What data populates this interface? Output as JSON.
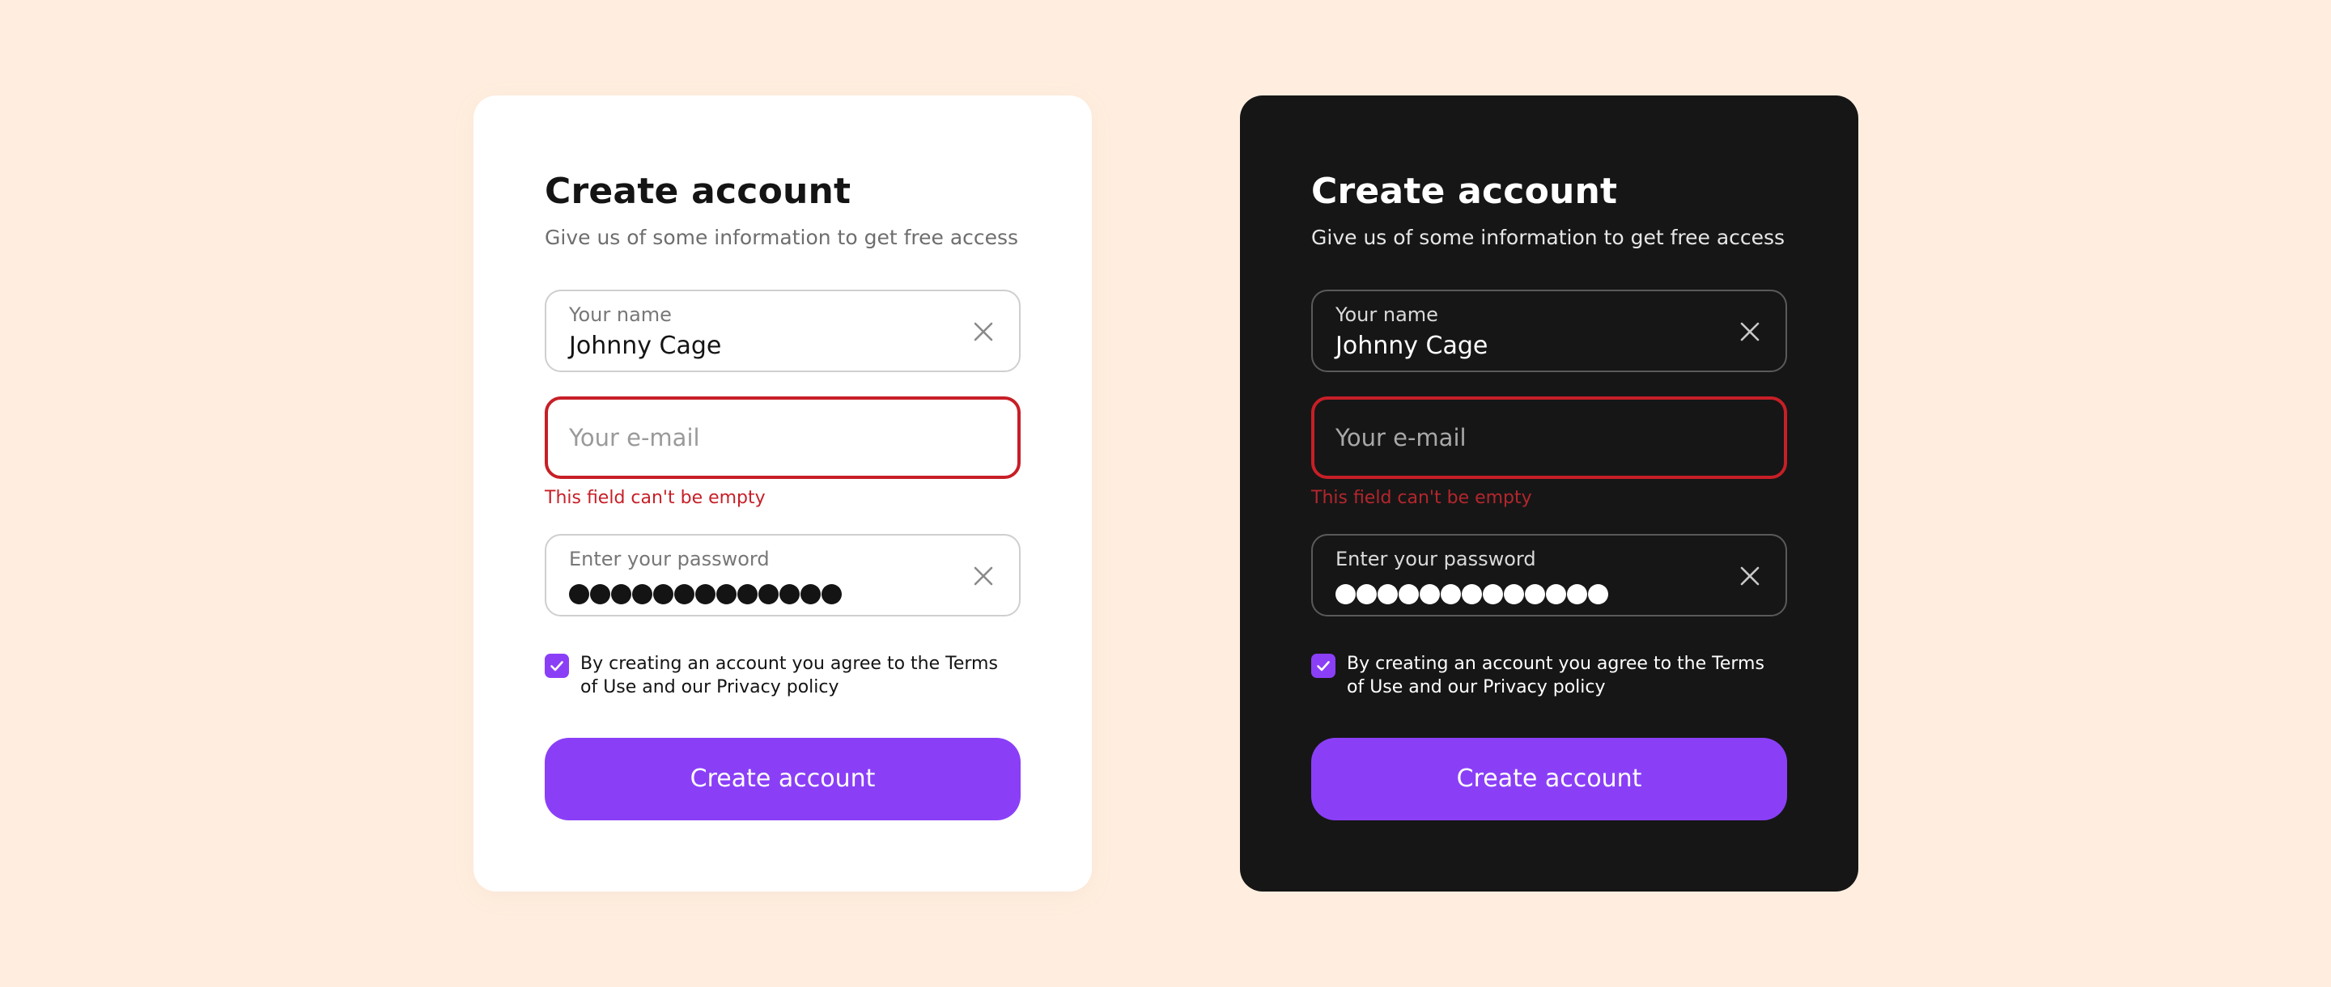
{
  "colors": {
    "background": "#FFEEDF",
    "accent": "#8A3FF7",
    "error": "#C71F27",
    "light_card": "#FFFFFF",
    "dark_card": "#161616"
  },
  "light": {
    "title": "Create account",
    "subtitle": "Give us of some information to get free access",
    "name_label": "Your name",
    "name_value": "Johnny Cage",
    "email_placeholder": "Your e-mail",
    "email_error": "This field can't be empty",
    "password_label": "Enter your password",
    "password_mask_count": 13,
    "terms_text": "By creating an account you agree to the Terms of Use and our Privacy policy",
    "terms_checked": true,
    "submit_label": "Create account"
  },
  "dark": {
    "title": "Create account",
    "subtitle": "Give us of some information to get free access",
    "name_label": "Your name",
    "name_value": "Johnny Cage",
    "email_placeholder": "Your e-mail",
    "email_error": "This field can't be empty",
    "password_label": "Enter your password",
    "password_mask_count": 13,
    "terms_text": "By creating an account you agree to the Terms of Use and our Privacy policy",
    "terms_checked": true,
    "submit_label": "Create account"
  },
  "icons": {
    "clear": "close-icon",
    "check": "checkmark-icon"
  }
}
